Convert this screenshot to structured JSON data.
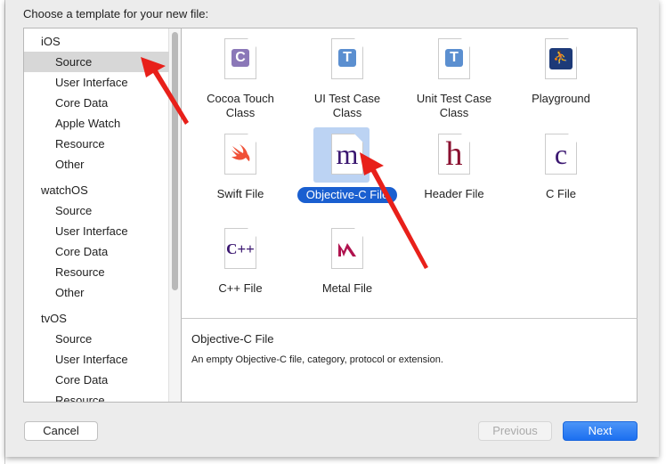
{
  "dialog": {
    "title": "Choose a template for your new file:"
  },
  "sidebar": {
    "groups": [
      {
        "label": "iOS",
        "items": [
          "Source",
          "User Interface",
          "Core Data",
          "Apple Watch",
          "Resource",
          "Other"
        ]
      },
      {
        "label": "watchOS",
        "items": [
          "Source",
          "User Interface",
          "Core Data",
          "Resource",
          "Other"
        ]
      },
      {
        "label": "tvOS",
        "items": [
          "Source",
          "User Interface",
          "Core Data",
          "Resource"
        ]
      }
    ],
    "selected": "iOS / Source"
  },
  "templates": [
    {
      "label": "Cocoa Touch Class",
      "icon": "cocoa-touch-class-icon",
      "glyph": "C",
      "color": "#8b78b8"
    },
    {
      "label": "UI Test Case Class",
      "icon": "ui-test-case-icon",
      "glyph": "T",
      "color": "#5b8fd0"
    },
    {
      "label": "Unit Test Case Class",
      "icon": "unit-test-case-icon",
      "glyph": "T",
      "color": "#5b8fd0"
    },
    {
      "label": "Playground",
      "icon": "playground-icon",
      "glyph": "⛹",
      "color": "#1d3a78"
    },
    {
      "label": "Swift File",
      "icon": "swift-icon",
      "glyph": "🐦",
      "color": "#f05138"
    },
    {
      "label": "Objective-C File",
      "icon": "objc-m-icon",
      "glyph": "m",
      "color": "#3a1670"
    },
    {
      "label": "Header File",
      "icon": "header-h-icon",
      "glyph": "h",
      "color": "#8a1030"
    },
    {
      "label": "C File",
      "icon": "c-file-icon",
      "glyph": "c",
      "color": "#3a1670"
    },
    {
      "label": "C++ File",
      "icon": "cpp-file-icon",
      "glyph": "C++",
      "color": "#3a1670"
    },
    {
      "label": "Metal File",
      "icon": "metal-file-icon",
      "glyph": "M",
      "color": "#b0124e"
    }
  ],
  "selected_template": "Objective-C File",
  "description": {
    "title": "Objective-C File",
    "text": "An empty Objective-C file, category, protocol or extension."
  },
  "buttons": {
    "cancel": "Cancel",
    "previous": "Previous",
    "next": "Next"
  },
  "colors": {
    "accent": "#1a5fd0",
    "annotation_arrow": "#e8201a"
  }
}
